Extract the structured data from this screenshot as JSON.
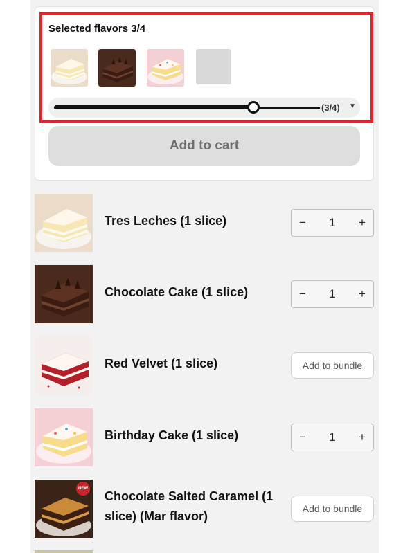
{
  "selection": {
    "title": "Selected flavors 3/4",
    "count_label": "(3/4)",
    "progress": 0.75,
    "thumbnails": [
      "tres-leches",
      "chocolate-cake",
      "birthday-cake",
      "empty-slot"
    ]
  },
  "cart": {
    "add_to_cart_label": "Add to cart"
  },
  "products": [
    {
      "name": "Tres Leches (1 slice)",
      "control": "stepper",
      "minus": "−",
      "qty": "1",
      "plus": "+"
    },
    {
      "name": "Chocolate Cake (1 slice)",
      "control": "stepper",
      "minus": "−",
      "qty": "1",
      "plus": "+"
    },
    {
      "name": "Red Velvet (1 slice)",
      "control": "bundle",
      "button_label": "Add to bundle"
    },
    {
      "name": "Birthday Cake (1 slice)",
      "control": "stepper",
      "minus": "−",
      "qty": "1",
      "plus": "+"
    },
    {
      "name": "Chocolate Salted Caramel (1 slice) (Mar flavor)",
      "control": "bundle",
      "button_label": "Add to bundle",
      "badge": "NEW"
    }
  ],
  "colors": {
    "highlight": "#e0262c",
    "button_disabled": "#dedede"
  }
}
